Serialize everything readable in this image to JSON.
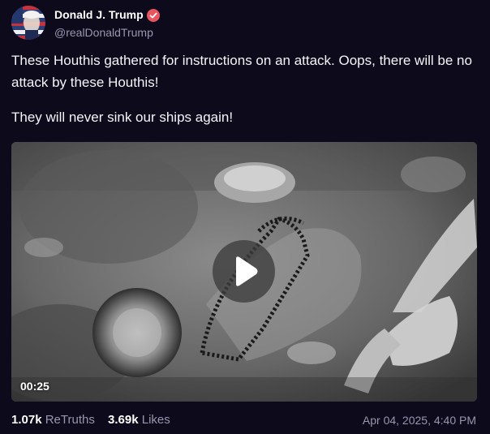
{
  "author": {
    "display_name": "Donald J. Trump",
    "handle": "@realDonaldTrump",
    "verified_badge": "verified-check-icon"
  },
  "post": {
    "paragraphs": [
      "These Houthis gathered for instructions on an attack. Oops, there will be no attack by these Houthis!",
      "They will never sink our ships again!"
    ]
  },
  "video": {
    "duration": "00:25",
    "play_icon": "play-icon"
  },
  "stats": {
    "retruths_count": "1.07k",
    "retruths_label": "ReTruths",
    "likes_count": "3.69k",
    "likes_label": "Likes"
  },
  "timestamp": "Apr 04, 2025, 4:40 PM",
  "colors": {
    "background": "#0d0a1c",
    "muted_text": "#9a96ad",
    "verified_badge": "#e8555f"
  }
}
